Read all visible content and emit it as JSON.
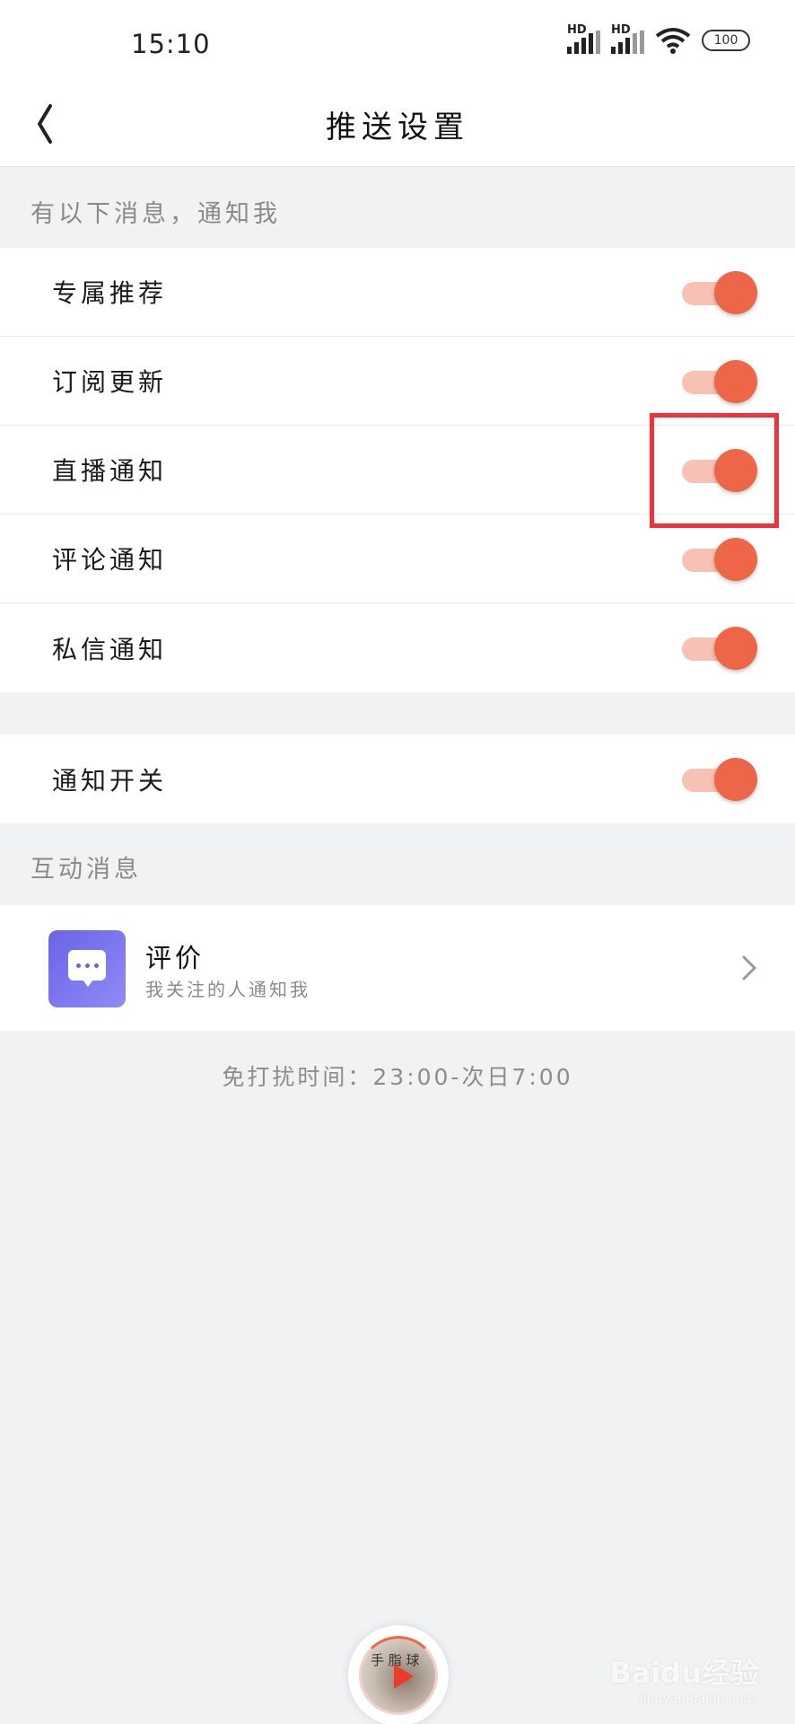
{
  "status_bar": {
    "time": "15:10",
    "signal_label_1": "HD",
    "signal_label_2": "HD",
    "battery": "100",
    "icons": [
      "signal-icon",
      "signal-icon",
      "wifi-icon",
      "battery-icon"
    ]
  },
  "header": {
    "title": "推送设置",
    "back_icon": "back-arrow-icon"
  },
  "notify_section": {
    "label": "有以下消息，通知我",
    "items": [
      {
        "label": "专属推荐",
        "enabled": true
      },
      {
        "label": "订阅更新",
        "enabled": true
      },
      {
        "label": "直播通知",
        "enabled": true
      },
      {
        "label": "评论通知",
        "enabled": true
      },
      {
        "label": "私信通知",
        "enabled": true
      }
    ]
  },
  "master_switch": {
    "label": "通知开关",
    "enabled": true
  },
  "interaction_section": {
    "label": "互动消息",
    "rating": {
      "title": "评价",
      "subtitle": "我关注的人通知我",
      "icon": "chat-bubble-icon"
    }
  },
  "dnd": {
    "text": "免打扰时间：23:00-次日7:00"
  },
  "mini_player": {
    "cover_text": "手 脂 球"
  },
  "watermark": {
    "brand": "Baidu经验",
    "url": "jingyan.baidu.com"
  },
  "colors": {
    "accent": "#ec6647",
    "toggle_track": "#f7c2b4",
    "highlight": "#f0323c",
    "background": "#f1f2f4"
  }
}
